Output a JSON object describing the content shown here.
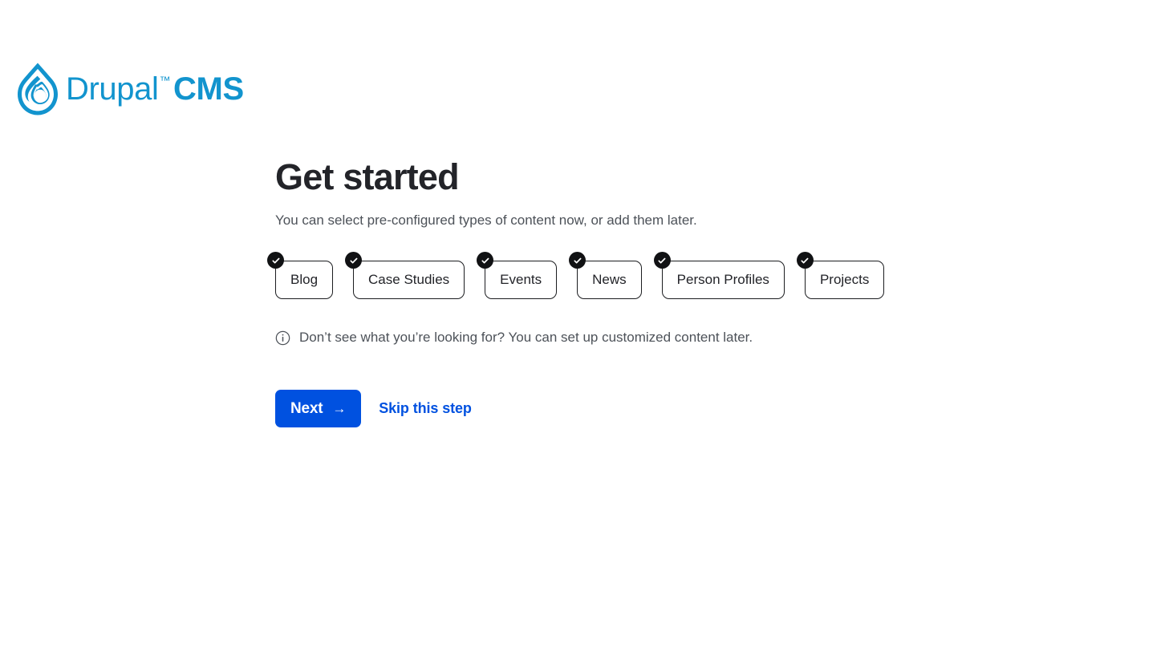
{
  "brand": {
    "logo_icon": "drupal-droplet-icon",
    "name": "Drupal",
    "trademark": "™",
    "product": "CMS",
    "logo_color": "#1294ce"
  },
  "main": {
    "title": "Get started",
    "subtitle": "You can select pre-configured types of content now, or add them later.",
    "content_types": [
      {
        "label": "Blog",
        "selected": true
      },
      {
        "label": "Case Studies",
        "selected": true
      },
      {
        "label": "Events",
        "selected": true
      },
      {
        "label": "News",
        "selected": true
      },
      {
        "label": "Person Profiles",
        "selected": true
      },
      {
        "label": "Projects",
        "selected": true
      }
    ],
    "note": {
      "icon": "info-circle-icon",
      "text": "Don’t see what you’re looking for? You can set up customized content later."
    }
  },
  "actions": {
    "next_label": "Next",
    "next_arrow": "→",
    "skip_label": "Skip this step",
    "accent_color": "#0051e0"
  }
}
